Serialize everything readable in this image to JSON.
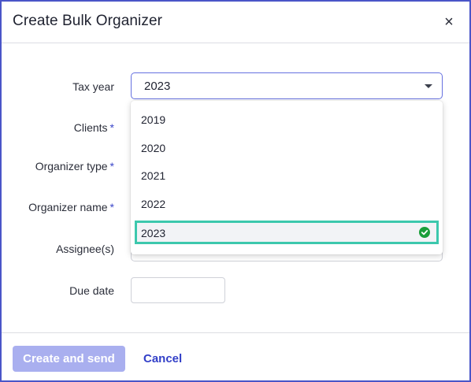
{
  "dialog": {
    "title": "Create Bulk Organizer",
    "close_icon": "close-icon"
  },
  "form": {
    "tax_year": {
      "label": "Tax year",
      "value": "2023"
    },
    "clients": {
      "label": "Clients",
      "required": "*"
    },
    "organizer_type": {
      "label": "Organizer type",
      "required": "*"
    },
    "organizer_name": {
      "label": "Organizer name",
      "required": "*"
    },
    "assignees": {
      "label": "Assignee(s)"
    },
    "due_date": {
      "label": "Due date",
      "value": ""
    }
  },
  "dropdown": {
    "options": [
      "2019",
      "2020",
      "2021",
      "2022",
      "2023"
    ],
    "selected": "2023",
    "selected_icon": "check-circle-icon"
  },
  "footer": {
    "create_label": "Create and send",
    "cancel_label": "Cancel"
  },
  "colors": {
    "accent": "#3340c8",
    "selected_border": "#3cc8ad",
    "check": "#1a9e3a",
    "disabled_button": "#a9afef"
  }
}
